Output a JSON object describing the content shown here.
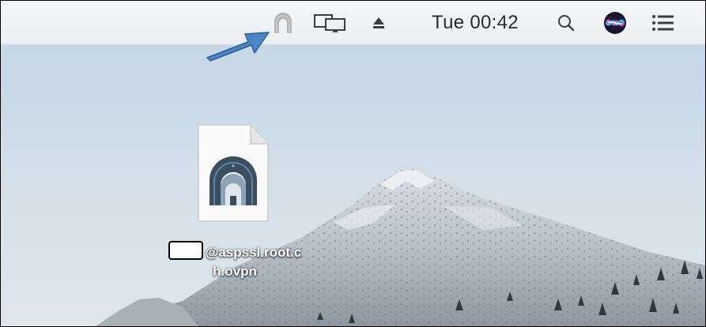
{
  "menubar": {
    "items": [
      {
        "name": "tunnelblick-icon"
      },
      {
        "name": "airplay-display-icon"
      },
      {
        "name": "eject-icon"
      },
      {
        "name": "siri-icon"
      },
      {
        "name": "notification-center-icon"
      },
      {
        "name": "spotlight-search-icon"
      }
    ],
    "clock": "Tue 00:42"
  },
  "annotation": {
    "arrow_color": "#4a86c8"
  },
  "desktop": {
    "file": {
      "name_line1": "@aspssl.root.c",
      "name_line2": "h.ovpn",
      "icon": "tunnelblick-config-file-icon"
    }
  },
  "colors": {
    "menubar_bg": "#eceef1",
    "sky": "#c9d9e8",
    "icon_gray": "#3e3e3e"
  }
}
